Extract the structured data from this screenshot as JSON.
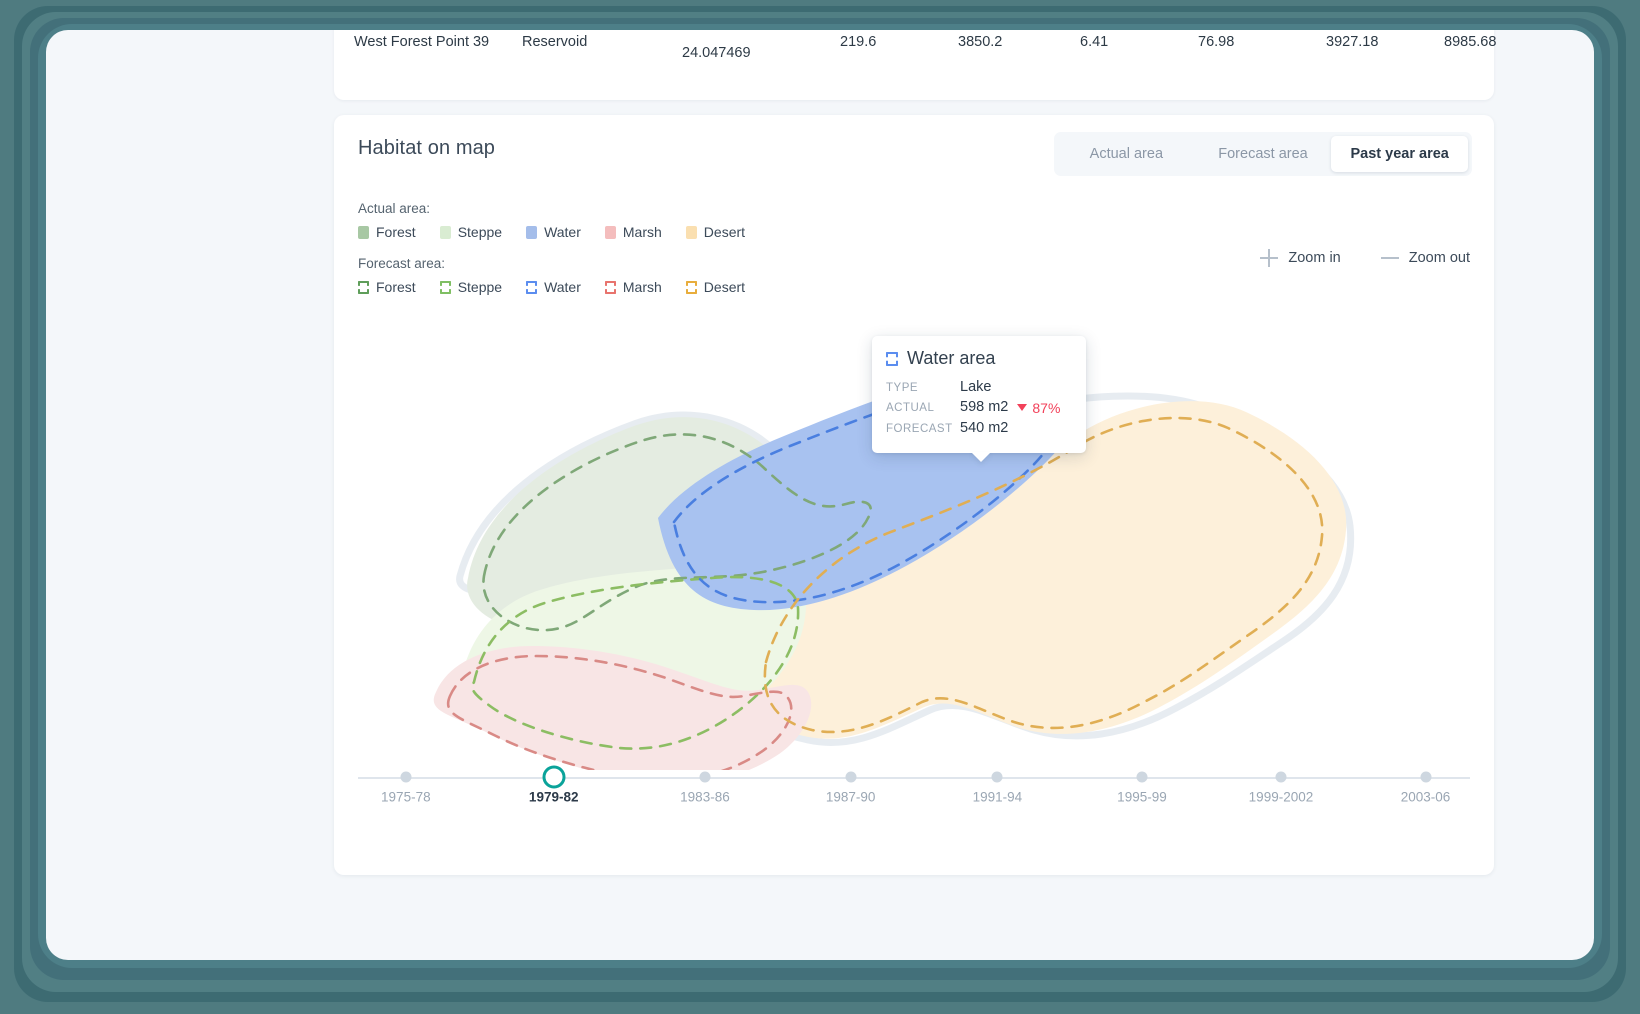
{
  "table_row": {
    "name": "West Forest Point 39",
    "type": "Reservoid",
    "coord": "24.047469",
    "v1": "219.6",
    "v2": "3850.2",
    "v3": "6.41",
    "v4": "76.98",
    "v5": "3927.18",
    "v6": "8985.68"
  },
  "card": {
    "title": "Habitat on map",
    "tabs": [
      {
        "label": "Actual area",
        "active": false
      },
      {
        "label": "Forecast area",
        "active": false
      },
      {
        "label": "Past year area",
        "active": true
      }
    ],
    "zoom_in_label": "Zoom in",
    "zoom_out_label": "Zoom out"
  },
  "legends": {
    "actual": {
      "caption": "Actual area:",
      "items": [
        {
          "label": "Forest",
          "color": "#a8c8a4"
        },
        {
          "label": "Steppe",
          "color": "#d9ecd2"
        },
        {
          "label": "Water",
          "color": "#a4bdea"
        },
        {
          "label": "Marsh",
          "color": "#f4bdbd"
        },
        {
          "label": "Desert",
          "color": "#fadfb0"
        }
      ]
    },
    "forecast": {
      "caption": "Forecast area:",
      "items": [
        {
          "label": "Forest",
          "color": "#5f9e5a"
        },
        {
          "label": "Steppe",
          "color": "#7fbf63"
        },
        {
          "label": "Water",
          "color": "#5b8def"
        },
        {
          "label": "Marsh",
          "color": "#e8736d"
        },
        {
          "label": "Desert",
          "color": "#e8ad3c"
        }
      ]
    }
  },
  "tooltip": {
    "title": "Water area",
    "swatch_color": "#5b8def",
    "rows": [
      {
        "key": "TYPE",
        "value": "Lake"
      },
      {
        "key": "ACTUAL",
        "value": "598 m2",
        "delta": "87%",
        "delta_dir": "down",
        "delta_color": "#f2415a"
      },
      {
        "key": "FORECAST",
        "value": "540 m2"
      }
    ]
  },
  "timeline": {
    "accent": "#0aa39a",
    "nodes": [
      {
        "label": "1975-78",
        "selected": false
      },
      {
        "label": "1979-82",
        "selected": true
      },
      {
        "label": "1983-86",
        "selected": false
      },
      {
        "label": "1987-90",
        "selected": false
      },
      {
        "label": "1991-94",
        "selected": false
      },
      {
        "label": "1995-99",
        "selected": false
      },
      {
        "label": "1999-2002",
        "selected": false
      },
      {
        "label": "2003-06",
        "selected": false
      }
    ]
  },
  "map": {
    "regions": [
      {
        "name": "forest",
        "fill": "#e4ece1",
        "dash": "#7fa878"
      },
      {
        "name": "steppe",
        "fill": "#eef7e6",
        "dash": "#8cbd63"
      },
      {
        "name": "water",
        "fill": "#a8c2f0",
        "dash": "#4a7fe0"
      },
      {
        "name": "marsh",
        "fill": "#f8e5e5",
        "dash": "#d98a86"
      },
      {
        "name": "desert",
        "fill": "#fdf0da",
        "dash": "#e0ae54"
      }
    ]
  }
}
